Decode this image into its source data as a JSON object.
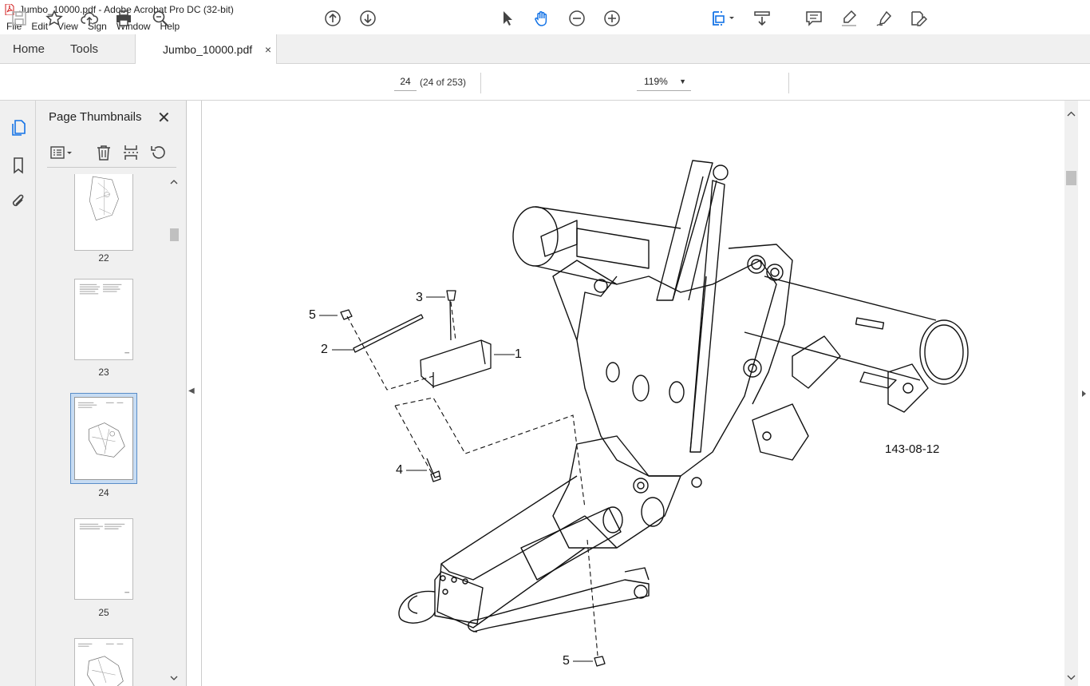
{
  "window": {
    "title": "Jumbo_10000.pdf - Adobe Acrobat Pro DC (32-bit)"
  },
  "menu": [
    "File",
    "Edit",
    "View",
    "Sign",
    "Window",
    "Help"
  ],
  "tabs": {
    "home": "Home",
    "tools": "Tools",
    "document": "Jumbo_10000.pdf",
    "close_glyph": "×"
  },
  "toolbar": {
    "page_number": "24",
    "page_count": "(24 of 253)",
    "zoom": "119%",
    "icons": [
      "save-icon",
      "bookmark-star-icon",
      "upload-icon",
      "print-icon",
      "search-zoom-icon",
      "prev-page-icon",
      "next-page-icon",
      "select-arrow-icon",
      "hand-tool-icon",
      "zoom-out-icon",
      "zoom-in-icon",
      "fit-page-icon",
      "scroll-mode-icon",
      "comment-icon",
      "highlight-icon",
      "sign-icon",
      "edit-pdf-icon"
    ]
  },
  "sidebar": {
    "title": "Page Thumbnails",
    "close_glyph": "✕",
    "thumbnails": [
      {
        "label": "22",
        "selected": false
      },
      {
        "label": "23",
        "selected": false
      },
      {
        "label": "24",
        "selected": true
      },
      {
        "label": "25",
        "selected": false
      },
      {
        "label": "",
        "selected": false
      }
    ]
  },
  "document": {
    "figure_id": "143-08-12",
    "callouts": [
      "1",
      "2",
      "3",
      "4",
      "5",
      "5"
    ]
  },
  "colors": {
    "accent": "#1473e6",
    "selection": "#c7dcf3"
  }
}
